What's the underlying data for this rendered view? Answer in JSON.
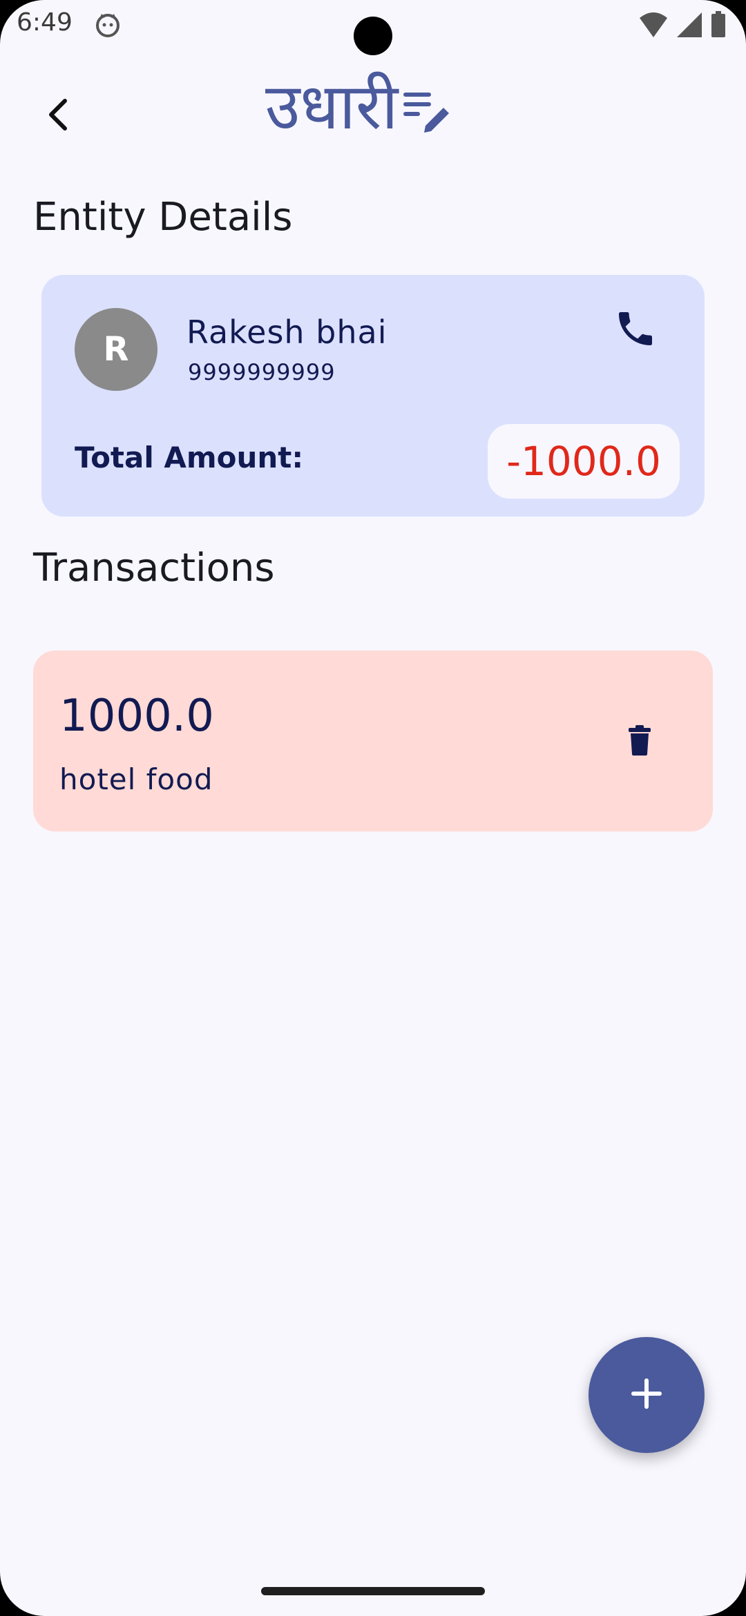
{
  "status_bar": {
    "time": "6:49"
  },
  "app_bar": {
    "logo_text": "उधारी",
    "back_icon": "arrow-back-icon",
    "logo_icon": "edit-note-icon"
  },
  "entity_section": {
    "title": "Entity Details",
    "avatar_initial": "R",
    "name": "Rakesh bhai",
    "phone": "9999999999",
    "call_icon": "phone-icon",
    "total_label": "Total Amount:",
    "total_value": "-1000.0"
  },
  "transactions_section": {
    "title": "Transactions",
    "items": [
      {
        "amount": "1000.0",
        "description": "hotel food",
        "delete_icon": "delete-icon"
      }
    ]
  },
  "fab": {
    "icon": "add-icon"
  },
  "colors": {
    "background": "#f8f7fe",
    "primary": "#4a5a9c",
    "entity_card": "#dbe1fd",
    "transaction_card": "#ffdad6",
    "negative_amount": "#e0281a",
    "on_card_text": "#121a52"
  }
}
